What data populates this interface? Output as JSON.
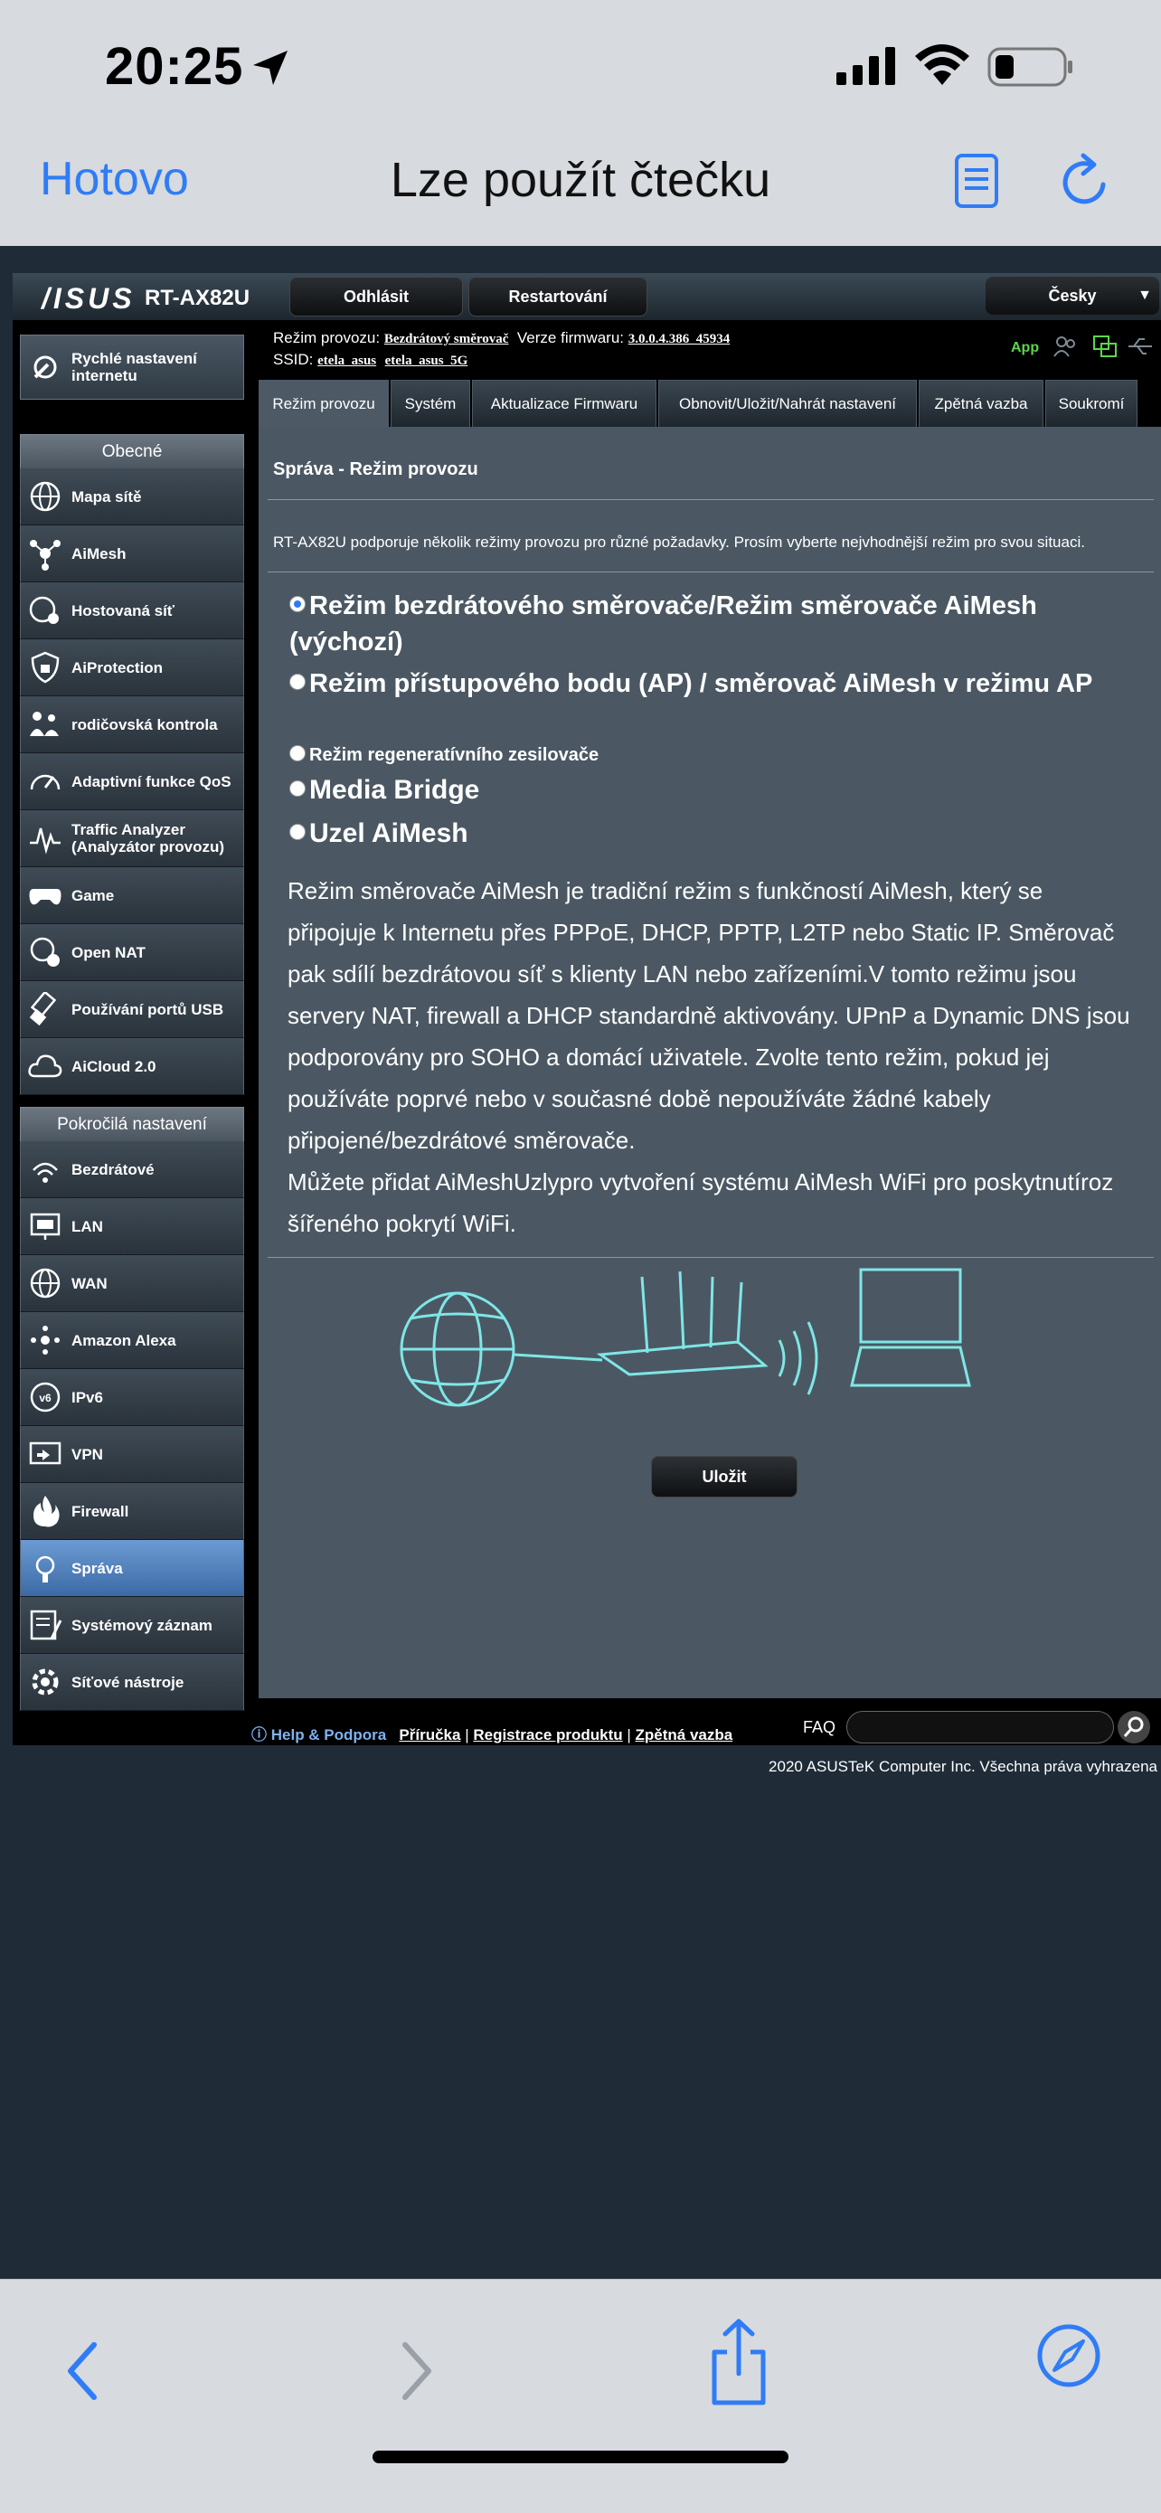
{
  "status_bar": {
    "time": "20:25"
  },
  "browser_nav": {
    "done_label": "Hotovo",
    "title": "Lze použít čtečku"
  },
  "router": {
    "brand": "/ISUS",
    "model": "RT-AX82U",
    "top_buttons": {
      "logout": "Odhlásit",
      "restart": "Restartování",
      "language": "Česky"
    },
    "info": {
      "mode_label": "Režim provozu:",
      "mode_value": "Bezdrátový směrovač",
      "fw_label": "Verze firmwaru:",
      "fw_value": "3.0.0.4.386_45934",
      "ssid_label": "SSID:",
      "ssid_1": "etela_asus",
      "ssid_2": "etela_asus_5G",
      "app_label": "App"
    },
    "sidebar": {
      "quick_setup": "Rychlé nastavení internetu",
      "general_header": "Obecné",
      "general_items": [
        "Mapa sítě",
        "AiMesh",
        "Hostovaná síť",
        "AiProtection",
        "rodičovská kontrola",
        "Adaptivní funkce QoS",
        "Traffic Analyzer (Analyzátor provozu)",
        "Game",
        "Open NAT",
        "Používání portů USB",
        "AiCloud 2.0"
      ],
      "advanced_header": "Pokročilá nastavení",
      "advanced_items": [
        "Bezdrátové",
        "LAN",
        "WAN",
        "Amazon Alexa",
        "IPv6",
        "VPN",
        "Firewall",
        "Správa",
        "Systémový záznam",
        "Síťové nástroje"
      ],
      "active_item": "Správa"
    },
    "tabs": [
      "Režim provozu",
      "Systém",
      "Aktualizace Firmwaru",
      "Obnovit/Uložit/Nahrát nastavení",
      "Zpětná vazba",
      "Soukromí"
    ],
    "active_tab": "Režim provozu",
    "panel": {
      "title": "Správa - Režim provozu",
      "description": "RT-AX82U podporuje několik režimy provozu pro různé požadavky. Prosím vyberte nejvhodnější režim pro svou situaci.",
      "options": [
        {
          "label": "Režim bezdrátového směrovače/Režim směrovače AiMesh (výchozí)",
          "checked": true
        },
        {
          "label": "Režim přístupového bodu (AP) / směrovač AiMesh v režimu AP",
          "checked": false
        },
        {
          "label": "Režim regeneratívního zesilovače",
          "checked": false
        },
        {
          "label": "Media Bridge",
          "checked": false
        },
        {
          "label": "Uzel AiMesh",
          "checked": false
        }
      ],
      "long_desc_1": "Režim směrovače AiMesh je tradiční režim s funkčností AiMesh, který se připojuje k Internetu přes PPPoE, DHCP, PPTP, L2TP nebo Static IP. Směrovač pak sdílí bezdrátovou síť s klienty LAN nebo zařízeními.V tomto režimu jsou servery NAT, firewall a DHCP standardně aktivovány. UPnP a Dynamic DNS jsou podporovány pro SOHO a domácí uživatele. Zvolte tento režim, pokud jej používáte poprvé nebo v současné době nepoužíváte žádné kabely připojené/bezdrátové směrovače.",
      "long_desc_2": "Můžete přidat AiMeshUzlypro vytvoření systému AiMesh WiFi pro poskytnutíroz šířeného pokrytí WiFi.",
      "save_label": "Uložit"
    },
    "footer": {
      "help": "Help & Podpora",
      "manual": "Příručka",
      "register": "Registrace produktu",
      "feedback": "Zpětná vazba",
      "faq": "FAQ",
      "copyright": "2020 ASUSTeK Computer Inc. Všechna práva vyhrazena"
    }
  },
  "colors": {
    "ios_blue": "#2f7cf6",
    "panel": "#4b5863",
    "active_sidebar": "#4f7fbf",
    "app_green": "#5cd64a"
  }
}
